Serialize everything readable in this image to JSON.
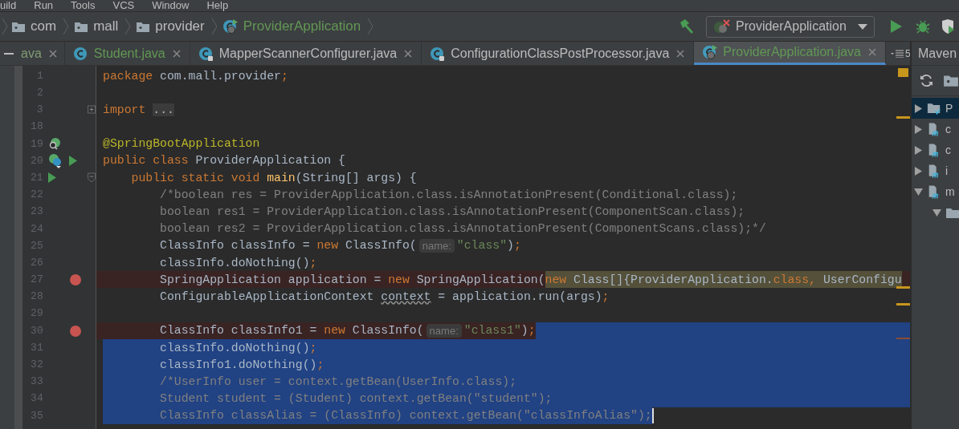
{
  "menu": [
    "uild",
    "Run",
    "Tools",
    "VCS",
    "Window",
    "Help"
  ],
  "breadcrumbs": [
    {
      "label": "com",
      "kind": "folder",
      "color": "#bbbbbb"
    },
    {
      "label": "mall",
      "kind": "folder",
      "color": "#bbbbbb"
    },
    {
      "label": "provider",
      "kind": "folder",
      "color": "#bbbbbb"
    },
    {
      "label": "ProviderApplication",
      "kind": "spring-class",
      "color": "#629755"
    }
  ],
  "run_config": {
    "label": "ProviderApplication"
  },
  "tabs": [
    {
      "label": "ava",
      "locked": false,
      "color": "#7f9a73",
      "selected": false
    },
    {
      "label": "Student.java",
      "kind": "class",
      "locked": false,
      "color": "#629755",
      "selected": false
    },
    {
      "label": "MapperScannerConfigurer.java",
      "kind": "class",
      "locked": true,
      "color": "#bbbbbb",
      "selected": false
    },
    {
      "label": "ConfigurationClassPostProcessor.java",
      "kind": "class",
      "locked": true,
      "color": "#bbbbbb",
      "selected": false
    },
    {
      "label": "ProviderApplication.java",
      "kind": "spring-class",
      "locked": false,
      "color": "#629755",
      "selected": true
    }
  ],
  "hidden_tabs": "5",
  "lines": [
    {
      "number": "1",
      "breakpoint": false,
      "selected": false,
      "tokens": [
        {
          "kind": "kw",
          "text": "package"
        },
        {
          "kind": "plain",
          "text": " com.mall.provider"
        },
        {
          "kind": "kw",
          "text": ";"
        }
      ]
    },
    {
      "number": "2",
      "breakpoint": false,
      "selected": false
    },
    {
      "number": "3",
      "breakpoint": false,
      "selected": false,
      "fold": {
        "kind": "collapsed"
      },
      "tokens": [
        {
          "kind": "kw",
          "text": "import"
        },
        {
          "kind": "folded",
          "text": "..."
        }
      ]
    },
    {
      "number": "18",
      "breakpoint": false,
      "selected": false
    },
    {
      "number": "19",
      "breakpoint": false,
      "selected": false,
      "markers": [
        {
          "kind": "bean-search"
        }
      ],
      "tokens": [
        {
          "kind": "annotation",
          "text": "@SpringBootApplication"
        }
      ]
    },
    {
      "number": "20",
      "breakpoint": false,
      "selected": false,
      "markers": [
        {
          "kind": "bean-class"
        },
        {
          "kind": "run"
        }
      ],
      "tokens": [
        {
          "kind": "kw",
          "text": "public class "
        },
        {
          "kind": "plain",
          "text": "ProviderApplication {"
        }
      ]
    },
    {
      "number": "21",
      "breakpoint": false,
      "selected": false,
      "fold": {
        "kind": "expanded"
      },
      "markers": [
        {
          "kind": "run"
        }
      ],
      "tokens": [
        {
          "kind": "kw",
          "text": "    public static void "
        },
        {
          "kind": "method",
          "text": "main"
        },
        {
          "kind": "plain",
          "text": "(String[] args) {"
        }
      ]
    },
    {
      "number": "22",
      "breakpoint": false,
      "selected": false,
      "tokens": [
        {
          "kind": "comment",
          "text": "        /*boolean res = ProviderApplication.class.isAnnotationPresent(Conditional.class);"
        }
      ]
    },
    {
      "number": "23",
      "breakpoint": false,
      "selected": false,
      "tokens": [
        {
          "kind": "comment",
          "text": "        boolean res1 = ProviderApplication.class.isAnnotationPresent(ComponentScan.class);"
        }
      ]
    },
    {
      "number": "24",
      "breakpoint": false,
      "selected": false,
      "tokens": [
        {
          "kind": "comment",
          "text": "        boolean res2 = ProviderApplication.class.isAnnotationPresent(ComponentScans.class);*/"
        }
      ]
    },
    {
      "number": "25",
      "breakpoint": false,
      "selected": false,
      "tokens": [
        {
          "kind": "plain",
          "text": "        ClassInfo classInfo = "
        },
        {
          "kind": "kw",
          "text": "new"
        },
        {
          "kind": "plain",
          "text": " ClassInfo("
        },
        {
          "kind": "hint",
          "text": "name:"
        },
        {
          "kind": "string",
          "text": "\"class\""
        },
        {
          "kind": "plain",
          "text": ")"
        },
        {
          "kind": "kw",
          "text": ";"
        }
      ]
    },
    {
      "number": "26",
      "breakpoint": false,
      "selected": false,
      "tokens": [
        {
          "kind": "plain",
          "text": "        classInfo.doNothing()"
        },
        {
          "kind": "kw",
          "text": ";"
        }
      ]
    },
    {
      "number": "27",
      "breakpoint": true,
      "selected": false,
      "tokens": [
        {
          "kind": "plain",
          "text": "        SpringApplication application = ",
          "highlight": false
        },
        {
          "kind": "kw",
          "text": "new",
          "highlight": false
        },
        {
          "kind": "plain",
          "text": " SpringApplication(",
          "highlight": false
        },
        {
          "kind": "kw",
          "text": "new",
          "highlight": true
        },
        {
          "kind": "plain",
          "text": " Class[]{ProviderApplication.",
          "highlight": true
        },
        {
          "kind": "kw",
          "text": "class, ",
          "highlight": true
        },
        {
          "kind": "plain",
          "text": "UserConfigu",
          "highlight": true
        }
      ]
    },
    {
      "number": "28",
      "breakpoint": false,
      "selected": false,
      "tokens": [
        {
          "kind": "plain",
          "text": "        ConfigurableApplicationContext "
        },
        {
          "kind": "warn",
          "text": "context"
        },
        {
          "kind": "plain",
          "text": " = application.run(args)"
        },
        {
          "kind": "kw",
          "text": ";"
        }
      ]
    },
    {
      "number": "29",
      "breakpoint": false,
      "selected": false
    },
    {
      "number": "30",
      "breakpoint": true,
      "selected": true,
      "selection": {
        "kind": "tail"
      },
      "tokens": [
        {
          "kind": "plain",
          "text": "        ClassInfo classInfo1 = "
        },
        {
          "kind": "kw",
          "text": "new"
        },
        {
          "kind": "plain",
          "text": " ClassInfo("
        },
        {
          "kind": "hint",
          "text": "name:"
        },
        {
          "kind": "string",
          "text": "\"class1\""
        },
        {
          "kind": "plain",
          "text": ")"
        },
        {
          "kind": "kw",
          "text": ";"
        }
      ]
    },
    {
      "number": "31",
      "breakpoint": false,
      "selected": true,
      "selection": {
        "kind": "full"
      },
      "tokens": [
        {
          "kind": "plain",
          "text": "        classInfo.doNothing()"
        },
        {
          "kind": "kw",
          "text": ";"
        }
      ]
    },
    {
      "number": "32",
      "breakpoint": false,
      "selected": true,
      "selection": {
        "kind": "full"
      },
      "tokens": [
        {
          "kind": "plain",
          "text": "        classInfo1.doNothing()"
        },
        {
          "kind": "kw",
          "text": ";"
        }
      ]
    },
    {
      "number": "33",
      "breakpoint": false,
      "selected": true,
      "selection": {
        "kind": "full"
      },
      "tokens": [
        {
          "kind": "comment",
          "text": "        /*UserInfo user = context.getBean(UserInfo.class);"
        }
      ]
    },
    {
      "number": "34",
      "breakpoint": false,
      "selected": true,
      "selection": {
        "kind": "full"
      },
      "tokens": [
        {
          "kind": "comment",
          "text": "        Student student = (Student) context.getBean(\"student\");"
        }
      ]
    },
    {
      "number": "35",
      "breakpoint": false,
      "selected": true,
      "selection": {
        "kind": "head"
      },
      "tokens": [
        {
          "kind": "comment",
          "text": "        ClassInfo classAlias = (ClassInfo) context.getBean(\"classInfoAlias\");"
        }
      ]
    }
  ],
  "maven": {
    "title": "Maven",
    "tree": [
      {
        "label": "P",
        "kind": "project",
        "expanded": false,
        "selected": true
      },
      {
        "label": "c",
        "kind": "module",
        "expanded": false,
        "selected": false
      },
      {
        "label": "c",
        "kind": "module",
        "expanded": false,
        "selected": false
      },
      {
        "label": "i",
        "kind": "module",
        "expanded": false,
        "selected": false
      },
      {
        "label": "m",
        "kind": "module",
        "expanded": true,
        "selected": false,
        "children": [
          {
            "kind": "folder",
            "expanded": true,
            "selected": false
          }
        ]
      }
    ]
  }
}
